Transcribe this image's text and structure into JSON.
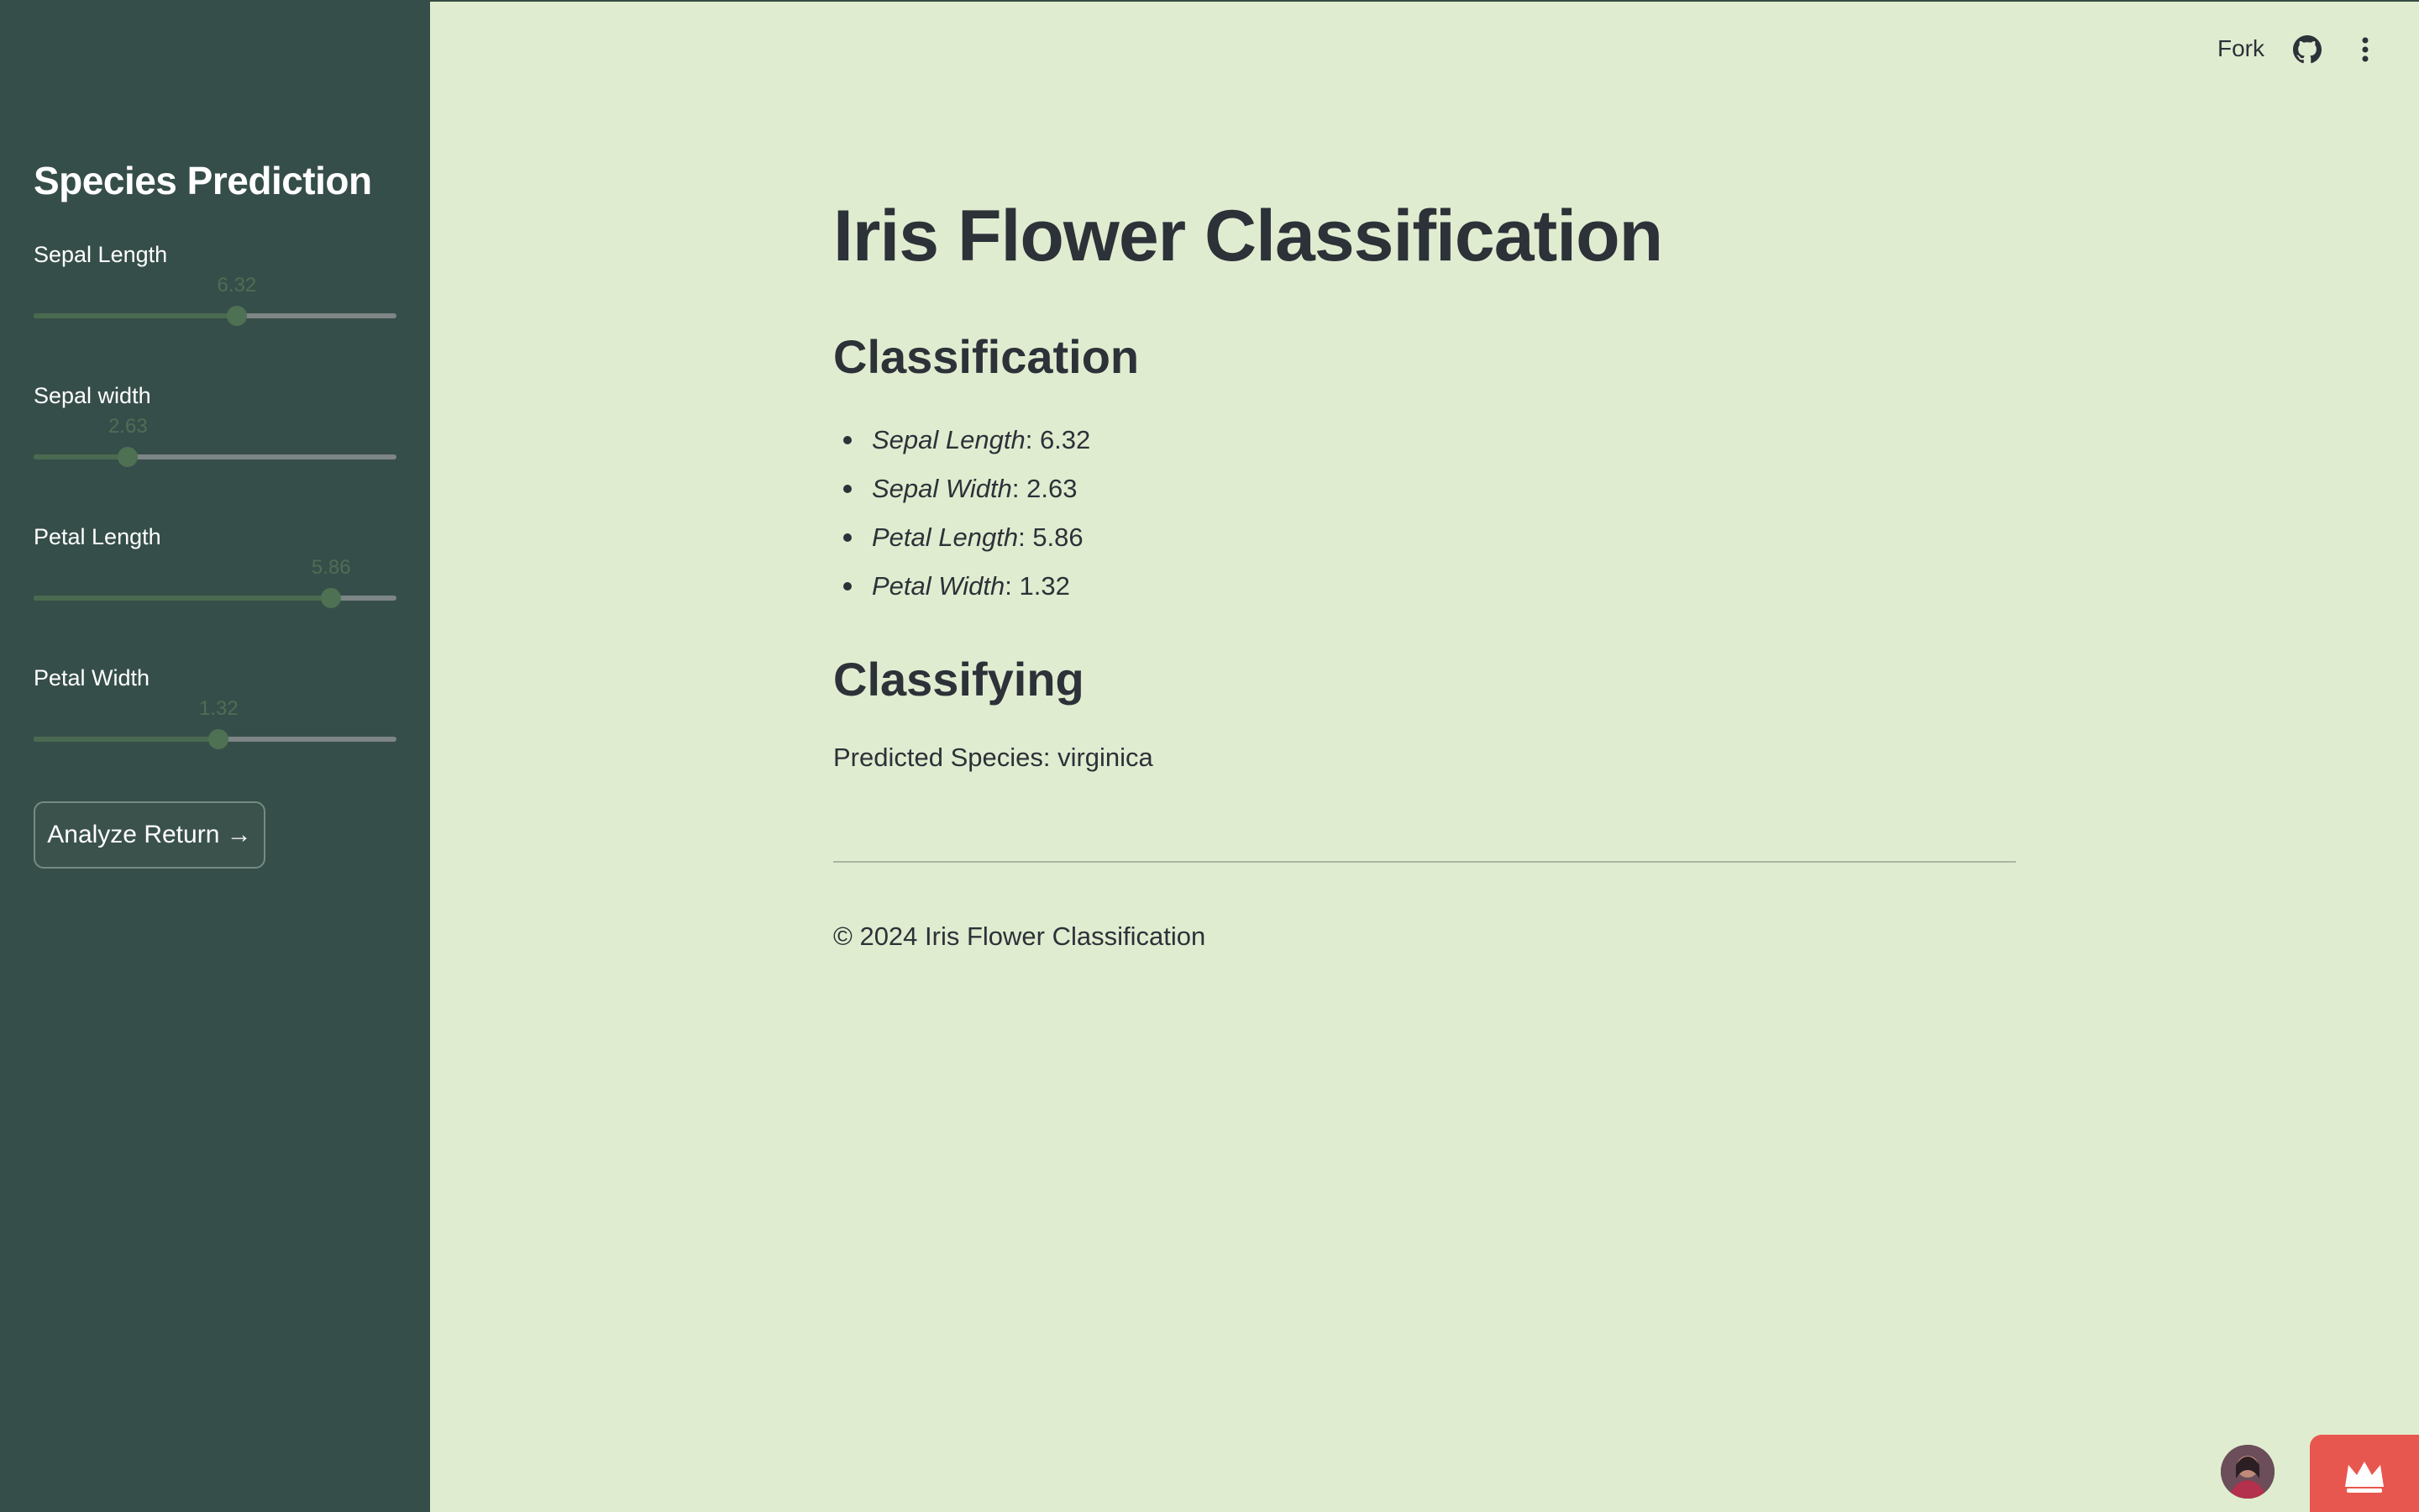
{
  "header": {
    "fork_label": "Fork",
    "icons": [
      "github-icon",
      "more-vertical-icon"
    ]
  },
  "sidebar": {
    "title": "Species Prediction",
    "sliders": [
      {
        "label": "Sepal Length",
        "value": "6.32",
        "fraction": 0.56
      },
      {
        "label": "Sepal width",
        "value": "2.63",
        "fraction": 0.26
      },
      {
        "label": "Petal Length",
        "value": "5.86",
        "fraction": 0.82
      },
      {
        "label": "Petal Width",
        "value": "1.32",
        "fraction": 0.51
      }
    ],
    "button_label": "Analyze Return →"
  },
  "main": {
    "title": "Iris Flower Classification",
    "classification_heading": "Classification",
    "features": [
      {
        "name": "Sepal Length",
        "value": ": 6.32"
      },
      {
        "name": "Sepal Width",
        "value": ": 2.63"
      },
      {
        "name": "Petal Length",
        "value": ": 5.86"
      },
      {
        "name": "Petal Width",
        "value": ": 1.32"
      }
    ],
    "classifying_heading": "Classifying",
    "prediction": "Predicted Species: virginica",
    "footer": "© 2024 Iris Flower Classification"
  },
  "colors": {
    "sidebar_bg": "#364e49",
    "main_bg": "#e0ecd0",
    "text": "#2d3138",
    "slider_fill": "#4a6a50",
    "badge": "#e8574f"
  },
  "bottom_right_icons": [
    "avatar",
    "crown-icon"
  ]
}
